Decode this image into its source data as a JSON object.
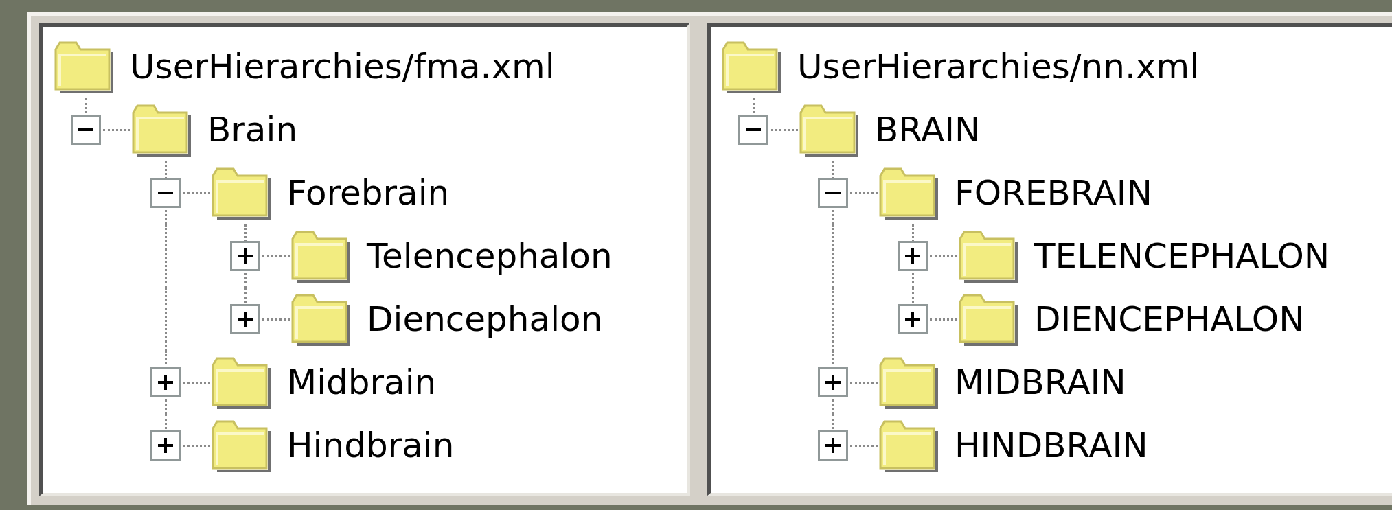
{
  "panels": [
    {
      "root": {
        "label": "UserHierarchies/fma.xml"
      },
      "children": [
        {
          "label": "Brain",
          "expanded": true,
          "children": [
            {
              "label": "Forebrain",
              "expanded": true,
              "children": [
                {
                  "label": "Telencephalon",
                  "expanded": false
                },
                {
                  "label": "Diencephalon",
                  "expanded": false
                }
              ]
            },
            {
              "label": "Midbrain",
              "expanded": false
            },
            {
              "label": "Hindbrain",
              "expanded": false
            }
          ]
        }
      ]
    },
    {
      "root": {
        "label": "UserHierarchies/nn.xml"
      },
      "children": [
        {
          "label": "BRAIN",
          "expanded": true,
          "children": [
            {
              "label": "FOREBRAIN",
              "expanded": true,
              "children": [
                {
                  "label": "TELENCEPHALON",
                  "expanded": false
                },
                {
                  "label": "DIENCEPHALON",
                  "expanded": false
                }
              ]
            },
            {
              "label": "MIDBRAIN",
              "expanded": false
            },
            {
              "label": "HINDBRAIN",
              "expanded": false
            }
          ]
        }
      ]
    }
  ]
}
